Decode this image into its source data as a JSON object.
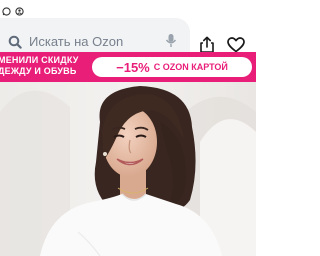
{
  "search": {
    "placeholder": "Искать на Ozon"
  },
  "promo": {
    "left_line1": "МЕНИЛИ СКИДКУ",
    "left_line2": "ДЕЖДУ И ОБУВЬ",
    "discount": "−15%",
    "card_text": "С OZON КАРТОЙ"
  },
  "colors": {
    "brand_pink": "#e91e79",
    "search_bg": "#f2f3f5"
  },
  "icons": [
    "whatsapp-icon",
    "contacts-icon",
    "search-icon",
    "mic-icon",
    "share-icon",
    "heart-icon"
  ]
}
